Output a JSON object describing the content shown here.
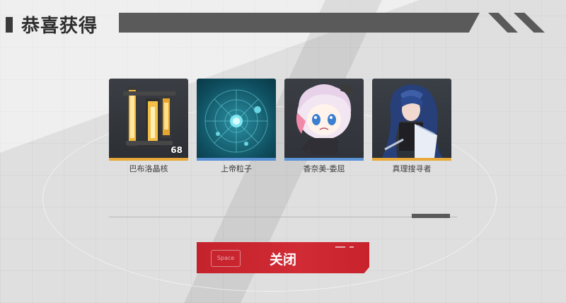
{
  "header": {
    "title": "恭喜获得"
  },
  "items": [
    {
      "name": "巴布洛晶核",
      "count": "68",
      "rarity_color": "#e8a93a",
      "icon": "crystal-core-icon"
    },
    {
      "name": "上帝粒子",
      "count": "",
      "rarity_color": "#5b93d6",
      "icon": "god-particle-icon"
    },
    {
      "name": "香奈美-委屈",
      "count": "",
      "rarity_color": "#5b93d6",
      "icon": "character-sticker-icon"
    },
    {
      "name": "真理搜寻者",
      "count": "",
      "rarity_color": "#e8a93a",
      "icon": "character-portrait-icon"
    }
  ],
  "close_button": {
    "key_hint": "Space",
    "label": "关闭"
  },
  "colors": {
    "accent_red": "#c8232d",
    "gold": "#e8a93a",
    "blue": "#5b93d6"
  }
}
